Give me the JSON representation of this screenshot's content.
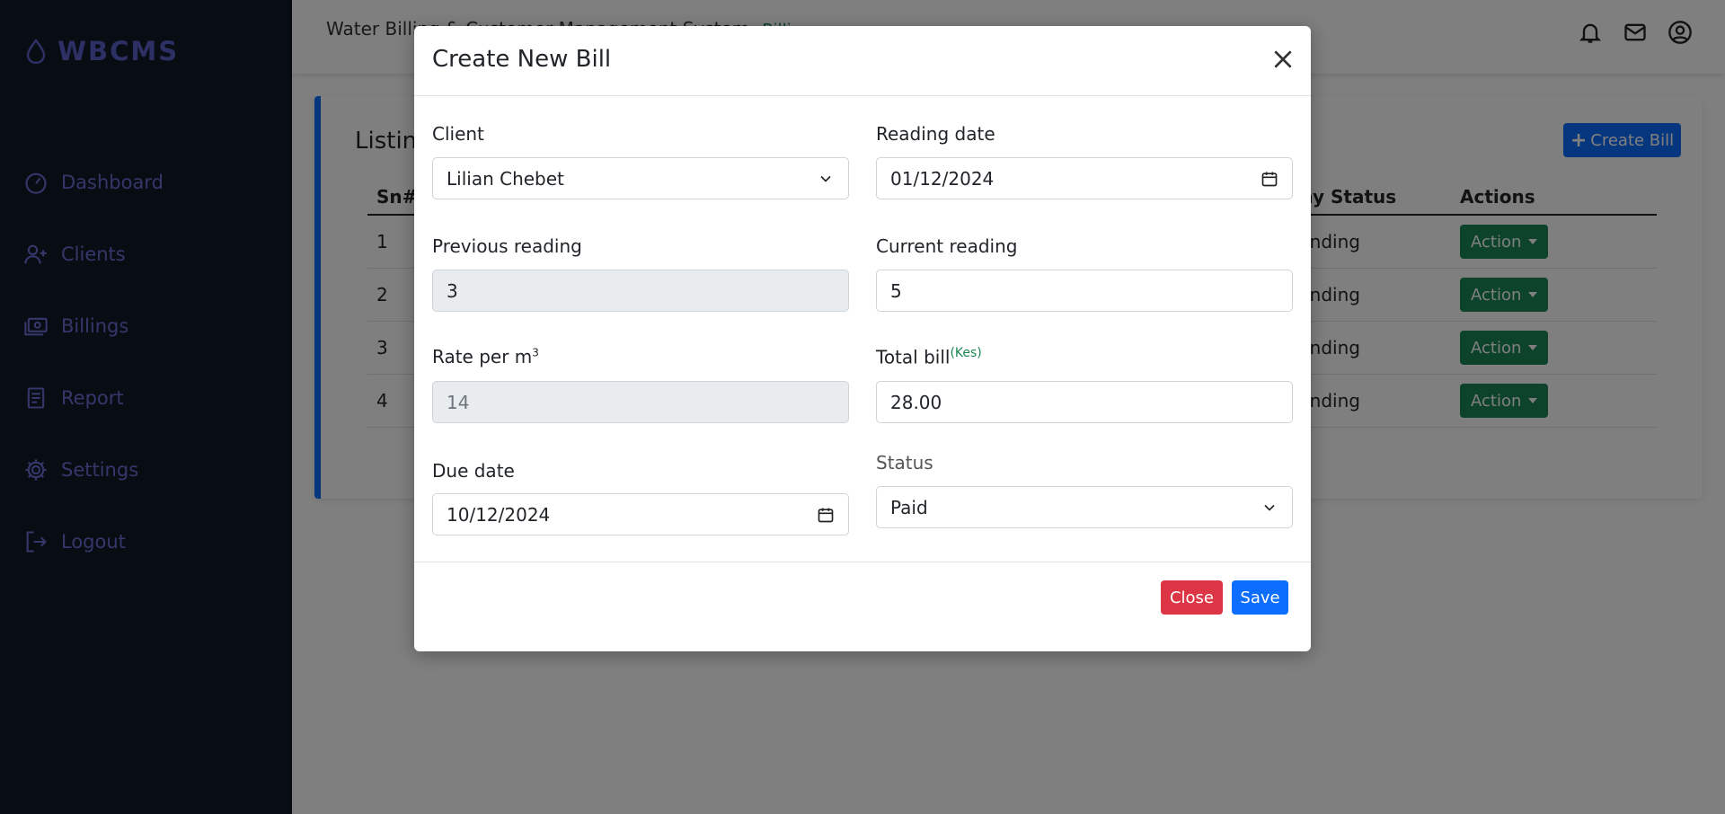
{
  "app": {
    "logo_text": "WBCMS",
    "title": "Water Billing & Customer Management System",
    "breadcrumb": "Billi"
  },
  "sidebar": {
    "items": [
      {
        "label": "Dashboard",
        "icon": "dashboard-icon"
      },
      {
        "label": "Clients",
        "icon": "users-icon"
      },
      {
        "label": "Billings",
        "icon": "billing-icon"
      },
      {
        "label": "Report",
        "icon": "report-icon"
      },
      {
        "label": "Settings",
        "icon": "gear-icon"
      },
      {
        "label": "Logout",
        "icon": "logout-icon"
      }
    ]
  },
  "topbar": {
    "icons": [
      "bell-icon",
      "mail-icon",
      "user-circle-icon"
    ]
  },
  "card": {
    "title": "Listing",
    "create_button": "Create Bill",
    "table": {
      "headers": {
        "sn": "Sn#",
        "pay_status": "Pay Status",
        "actions": "Actions"
      },
      "rows": [
        {
          "sn": "1",
          "pay_status": "Pending",
          "action": "Action"
        },
        {
          "sn": "2",
          "pay_status": "Pending",
          "action": "Action"
        },
        {
          "sn": "3",
          "pay_status": "Pending",
          "action": "Action"
        },
        {
          "sn": "4",
          "pay_status": "Pending",
          "action": "Action"
        }
      ]
    }
  },
  "modal": {
    "title": "Create New Bill",
    "fields": {
      "client": {
        "label": "Client",
        "value": "Lilian Chebet"
      },
      "reading_date": {
        "label": "Reading date",
        "value": "01/12/2024"
      },
      "previous_reading": {
        "label": "Previous reading",
        "value": "3"
      },
      "current_reading": {
        "label": "Current reading",
        "value": "5"
      },
      "rate": {
        "label": "Rate per m",
        "sup": "3",
        "value": "14"
      },
      "total_bill": {
        "label": "Total bill",
        "unit": "(Kes)",
        "value": "28.00"
      },
      "due_date": {
        "label": "Due date",
        "value": "10/12/2024"
      },
      "status": {
        "label": "Status",
        "value": "Paid"
      }
    },
    "footer": {
      "close_label": "Close",
      "save_label": "Save"
    }
  },
  "colors": {
    "sidebar_bg": "#111827",
    "accent": "#5b60c9",
    "primary": "#0d6efd",
    "danger": "#dc3545",
    "success": "#198754"
  }
}
